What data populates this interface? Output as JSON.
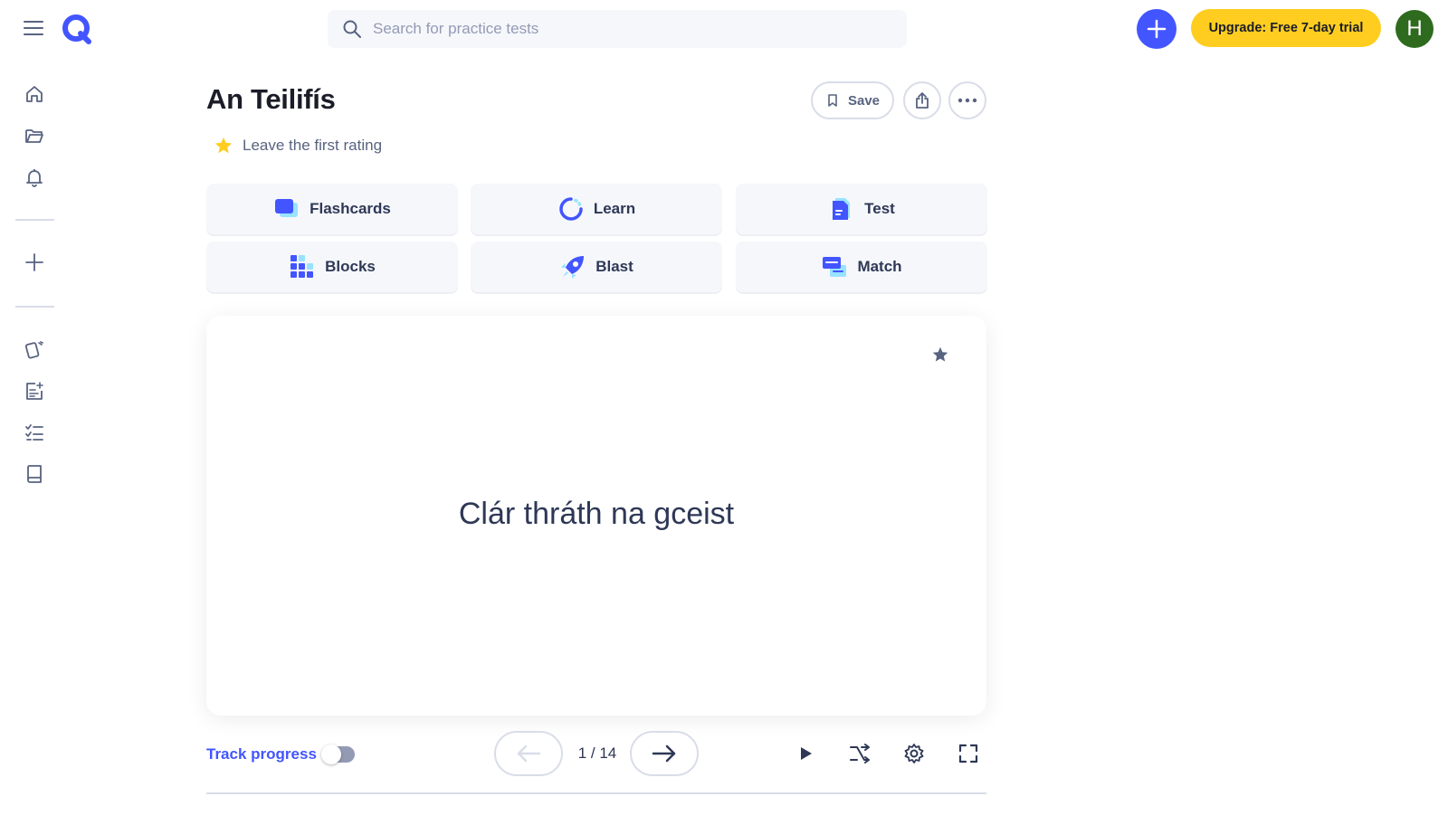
{
  "search": {
    "placeholder": "Search for practice tests"
  },
  "header": {
    "upgrade_label": "Upgrade: Free 7-day trial",
    "avatar_initial": "H",
    "accent_color": "#4255ff",
    "upgrade_color": "#ffcd1f"
  },
  "sidebar": {
    "icons": [
      "home-icon",
      "folder-icon",
      "bell-icon",
      "plus-icon",
      "flashcards-icon",
      "expert-solutions-icon",
      "checklist-icon",
      "book-icon"
    ]
  },
  "set": {
    "title": "An Teilifís",
    "rating_label": "Leave the first rating",
    "save_label": "Save"
  },
  "modes": [
    {
      "label": "Flashcards",
      "icon": "flashcards-mode-icon"
    },
    {
      "label": "Learn",
      "icon": "learn-mode-icon"
    },
    {
      "label": "Test",
      "icon": "test-mode-icon"
    },
    {
      "label": "Blocks",
      "icon": "blocks-mode-icon"
    },
    {
      "label": "Blast",
      "icon": "blast-mode-icon"
    },
    {
      "label": "Match",
      "icon": "match-mode-icon"
    }
  ],
  "card": {
    "term": "Clár thráth na gceist"
  },
  "controls": {
    "track_progress_label": "Track progress",
    "track_progress_on": false,
    "counter": "1 / 14"
  }
}
